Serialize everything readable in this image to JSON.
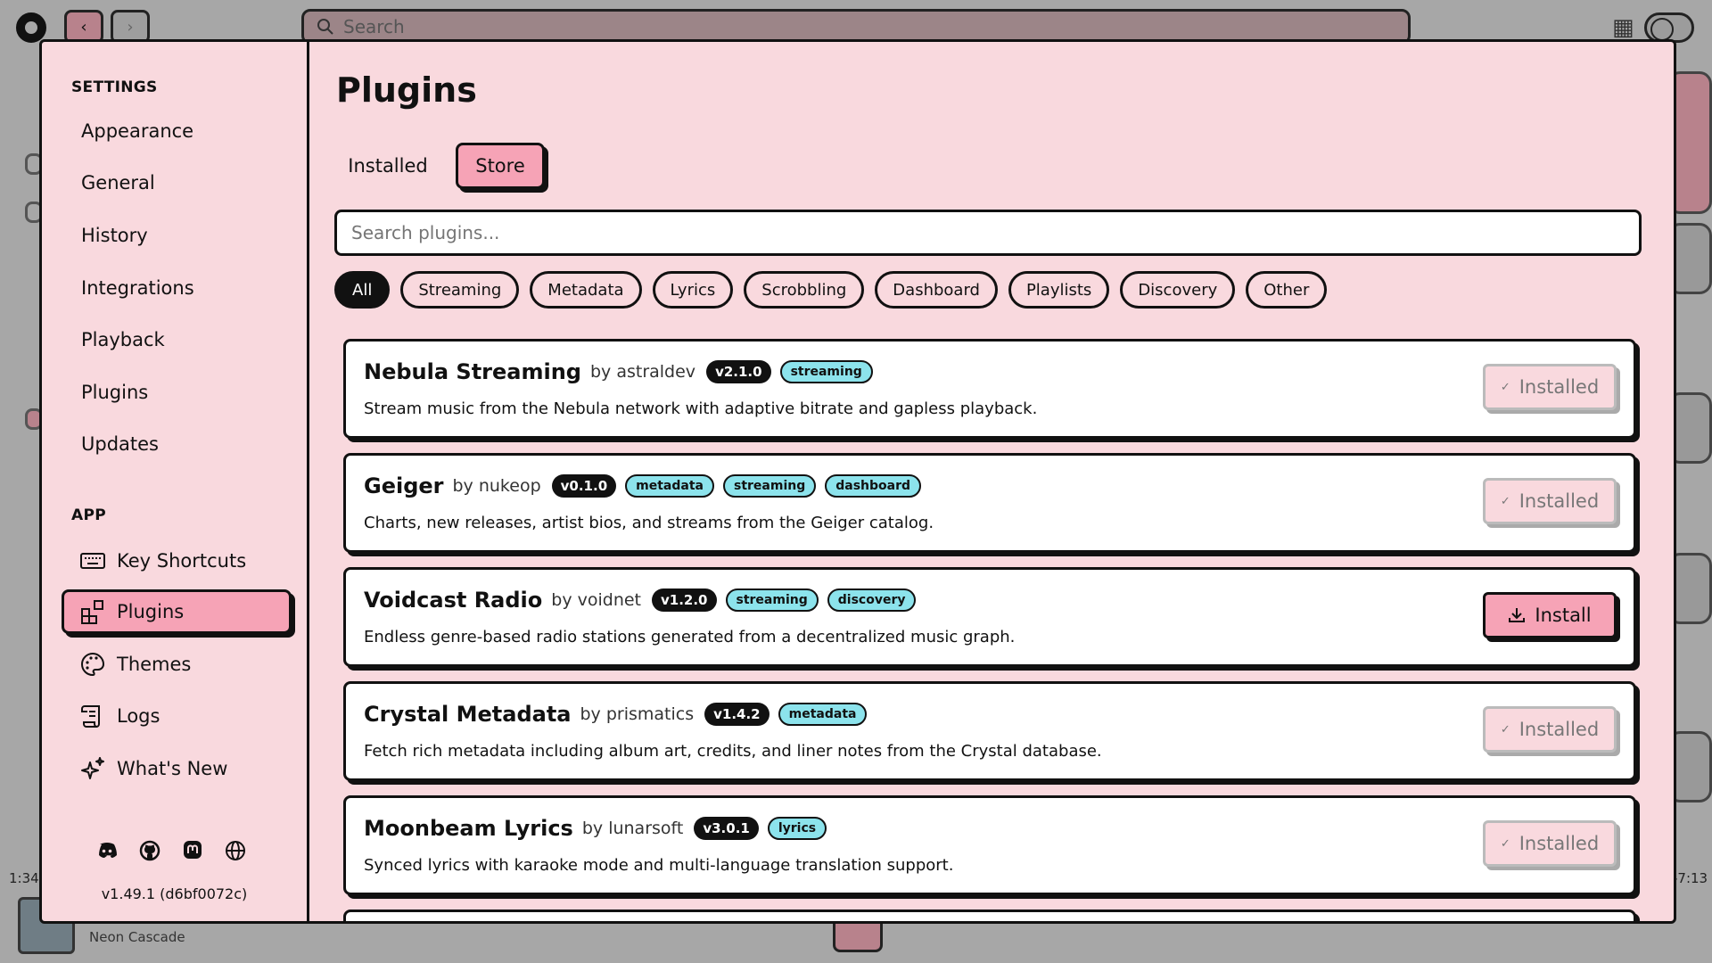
{
  "topbar": {
    "search_placeholder": "Search",
    "back_icon": "chevron-left-icon",
    "forward_icon": "chevron-right-icon"
  },
  "player": {
    "elapsed": "1:34",
    "remaining": "-7:13",
    "track_title": "Neon Cascade"
  },
  "sidebar": {
    "settings_heading": "SETTINGS",
    "settings_items": [
      "Appearance",
      "General",
      "History",
      "Integrations",
      "Playback",
      "Plugins",
      "Updates"
    ],
    "app_heading": "APP",
    "app_items": [
      {
        "label": "Key Shortcuts",
        "icon": "keyboard-icon"
      },
      {
        "label": "Plugins",
        "icon": "puzzle-icon",
        "active": true
      },
      {
        "label": "Themes",
        "icon": "palette-icon"
      },
      {
        "label": "Logs",
        "icon": "scroll-icon"
      },
      {
        "label": "What's New",
        "icon": "sparkles-icon"
      }
    ],
    "social_icons": [
      "discord-icon",
      "github-icon",
      "mastodon-icon",
      "globe-icon"
    ],
    "version": "v1.49.1 (d6bf0072c)"
  },
  "main": {
    "title": "Plugins",
    "tabs": [
      {
        "label": "Installed",
        "active": false
      },
      {
        "label": "Store",
        "active": true
      }
    ],
    "search_placeholder": "Search plugins...",
    "chips": [
      "All",
      "Streaming",
      "Metadata",
      "Lyrics",
      "Scrobbling",
      "Dashboard",
      "Playlists",
      "Discovery",
      "Other"
    ],
    "active_chip": "All",
    "plugins": [
      {
        "name": "Nebula Streaming",
        "author": "by astraldev",
        "version": "v2.1.0",
        "tags": [
          "streaming"
        ],
        "description": "Stream music from the Nebula network with adaptive bitrate and gapless playback.",
        "action": "Installed",
        "installed": true
      },
      {
        "name": "Geiger",
        "author": "by nukeop",
        "version": "v0.1.0",
        "tags": [
          "metadata",
          "streaming",
          "dashboard"
        ],
        "description": "Charts, new releases, artist bios, and streams from the Geiger catalog.",
        "action": "Installed",
        "installed": true
      },
      {
        "name": "Voidcast Radio",
        "author": "by voidnet",
        "version": "v1.2.0",
        "tags": [
          "streaming",
          "discovery"
        ],
        "description": "Endless genre-based radio stations generated from a decentralized music graph.",
        "action": "Install",
        "installed": false
      },
      {
        "name": "Crystal Metadata",
        "author": "by prismatics",
        "version": "v1.4.2",
        "tags": [
          "metadata"
        ],
        "description": "Fetch rich metadata including album art, credits, and liner notes from the Crystal database.",
        "action": "Installed",
        "installed": true
      },
      {
        "name": "Moonbeam Lyrics",
        "author": "by lunarsoft",
        "version": "v3.0.1",
        "tags": [
          "lyrics"
        ],
        "description": "Synced lyrics with karaoke mode and multi-language translation support.",
        "action": "Installed",
        "installed": true
      }
    ]
  },
  "colors": {
    "modal_bg": "#f9d9de",
    "accent_pink": "#f6a3b6",
    "tag_cyan": "#8ce3ec",
    "ink": "#111111"
  }
}
